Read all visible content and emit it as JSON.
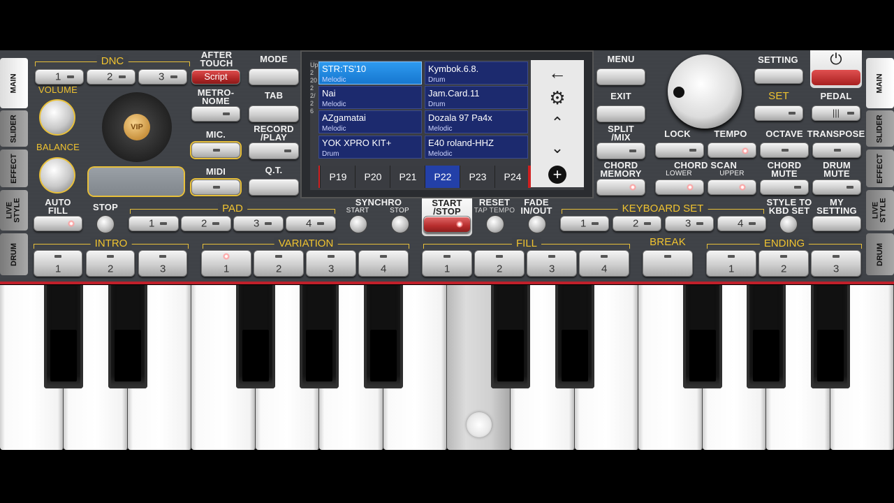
{
  "side_tabs": [
    "MAIN",
    "SLIDER",
    "EFFECT",
    "LIVE\nSTYLE",
    "DRUM"
  ],
  "left": {
    "dnc_label": "DNC",
    "dnc_buttons": [
      "1",
      "2",
      "3"
    ],
    "after_touch_label": "AFTER\nTOUCH",
    "script_button": "Script",
    "volume_label": "VOLUME",
    "balance_label": "BALANCE",
    "metronome_label": "METRO-\nNOME",
    "mic_label": "MIC.",
    "midi_label": "MIDI",
    "vip_label": "VIP",
    "auto_fill_label": "AUTO\nFILL",
    "stop_label": "STOP",
    "pad_label": "PAD",
    "pad_buttons": [
      "1",
      "2",
      "3",
      "4"
    ],
    "synchro_label": "SYNCHRO",
    "synchro_start": "START",
    "synchro_stop": "STOP"
  },
  "center": {
    "mode_label": "MODE",
    "tab_label": "TAB",
    "record_label": "RECORD\n/PLAY",
    "qt_label": "Q.T.",
    "start_stop_label": "START\n/STOP",
    "reset_label": "RESET",
    "tap_tempo_label": "TAP TEMPO",
    "fade_label": "FADE\nIN/OUT"
  },
  "screen": {
    "rows_side_label": "Up 2 20 2 2/2 6",
    "cells": [
      {
        "name": "STR:TS'10",
        "type": "Melodic",
        "selected": true
      },
      {
        "name": "Kymbok.6.8.",
        "type": "Drum",
        "selected": false
      },
      {
        "name": "Nai",
        "type": "Melodic",
        "selected": false
      },
      {
        "name": "Jam.Card.11",
        "type": "Drum",
        "selected": false
      },
      {
        "name": "AZgamatai",
        "type": "Melodic",
        "selected": false
      },
      {
        "name": "Dozala 97 Pa4x",
        "type": "Melodic",
        "selected": false
      },
      {
        "name": "YOK XPRO KIT+",
        "type": "Drum",
        "selected": false
      },
      {
        "name": "E40 roland-HHZ",
        "type": "Melodic",
        "selected": false
      }
    ],
    "pages": [
      "P19",
      "P20",
      "P21",
      "P22",
      "P23",
      "P24"
    ],
    "selected_page": "P22"
  },
  "right": {
    "menu_label": "MENU",
    "exit_label": "EXIT",
    "split_label": "SPLIT\n/MIX",
    "chord_memory_label": "CHORD\nMEMORY",
    "setting_label": "SETTING",
    "set_label": "SET",
    "pedal_label": "PEDAL",
    "lock_label": "LOCK",
    "tempo_label": "TEMPO",
    "octave_label": "OCTAVE",
    "transpose_label": "TRANSPOSE",
    "chord_scan_label": "CHORD SCAN",
    "lower_label": "LOWER",
    "upper_label": "UPPER",
    "chord_mute_label": "CHORD\nMUTE",
    "drum_mute_label": "DRUM\nMUTE",
    "keyboard_set_label": "KEYBOARD SET",
    "keyboard_set_buttons": [
      "1",
      "2",
      "3",
      "4"
    ],
    "style_to_kbd_label": "STYLE TO\nKBD SET",
    "my_setting_label": "MY\nSETTING"
  },
  "bottom": {
    "intro_label": "INTRO",
    "intro_buttons": [
      "1",
      "2",
      "3"
    ],
    "variation_label": "VARIATION",
    "variation_buttons": [
      "1",
      "2",
      "3",
      "4"
    ],
    "fill_label": "FILL",
    "fill_buttons": [
      "1",
      "2",
      "3",
      "4"
    ],
    "break_label": "BREAK",
    "ending_label": "ENDING",
    "ending_buttons": [
      "1",
      "2",
      "3"
    ]
  },
  "keyboard": {
    "white_keys": 14,
    "pressed_key_index": 7
  }
}
